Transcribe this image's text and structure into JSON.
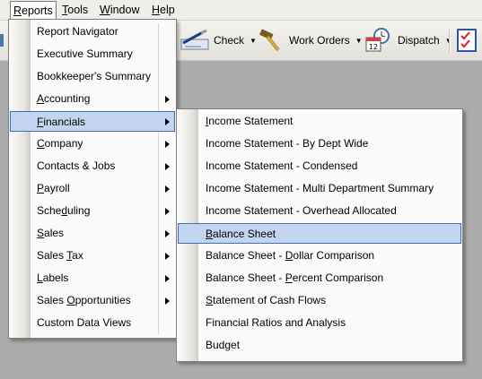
{
  "menubar": {
    "items": [
      {
        "label": "Reports",
        "accel": "R",
        "rest": "eports"
      },
      {
        "label": "Tools",
        "accel": "T",
        "rest": "ools"
      },
      {
        "label": "Window",
        "accel": "W",
        "rest": "indow"
      },
      {
        "label": "Help",
        "accel": "H",
        "rest": "elp"
      }
    ]
  },
  "toolbar": {
    "check_label": "Check",
    "workorders_label": "Work Orders",
    "dispatch_label": "Dispatch",
    "calendar_day": "12"
  },
  "reports_menu": {
    "items": [
      {
        "label": "Report Navigator"
      },
      {
        "label": "Executive Summary"
      },
      {
        "label": "Bookkeeper's Summary"
      },
      {
        "pre": "",
        "accel": "A",
        "rest": "ccounting"
      },
      {
        "pre": "",
        "accel": "F",
        "rest": "inancials"
      },
      {
        "pre": "",
        "accel": "C",
        "rest": "ompany"
      },
      {
        "label": "Contacts & Jobs"
      },
      {
        "pre": "",
        "accel": "P",
        "rest": "ayroll"
      },
      {
        "pre": "Sche",
        "accel": "d",
        "rest": "uling"
      },
      {
        "pre": "",
        "accel": "S",
        "rest": "ales"
      },
      {
        "pre": "Sales ",
        "accel": "T",
        "rest": "ax"
      },
      {
        "pre": "",
        "accel": "L",
        "rest": "abels"
      },
      {
        "pre": "Sales ",
        "accel": "O",
        "rest": "pportunities"
      },
      {
        "label": "Custom Data Views"
      }
    ]
  },
  "financials_menu": {
    "items": [
      {
        "pre": "",
        "accel": "I",
        "rest": "ncome Statement"
      },
      {
        "label": "Income Statement - By Dept Wide"
      },
      {
        "label": "Income Statement - Condensed"
      },
      {
        "label": "Income Statement - Multi Department Summary"
      },
      {
        "label": "Income Statement - Overhead Allocated"
      },
      {
        "pre": "",
        "accel": "B",
        "rest": "alance Sheet"
      },
      {
        "pre": "Balance Sheet - ",
        "accel": "D",
        "rest": "ollar Comparison"
      },
      {
        "pre": "Balance Sheet - ",
        "accel": "P",
        "rest": "ercent Comparison"
      },
      {
        "pre": "",
        "accel": "S",
        "rest": "tatement of Cash Flows"
      },
      {
        "label": "Financial Ratios and Analysis"
      },
      {
        "label": "Budget"
      }
    ]
  }
}
